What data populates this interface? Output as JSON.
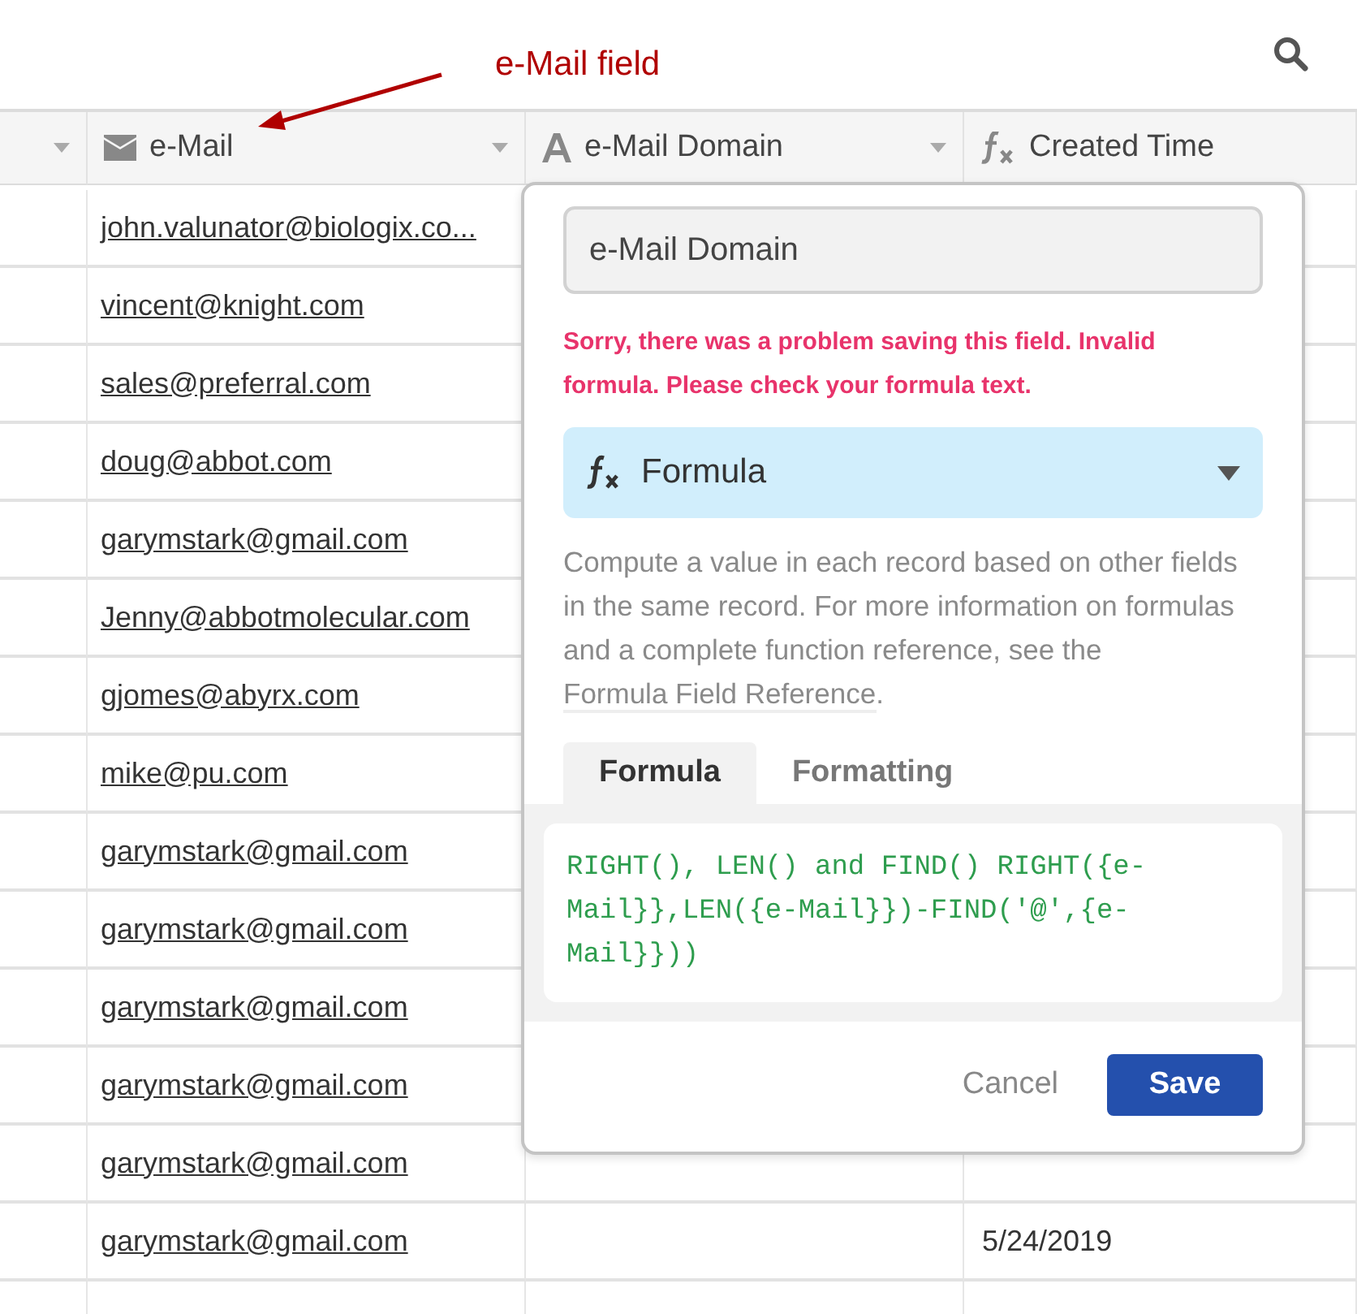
{
  "annotation": {
    "text": "e-Mail field"
  },
  "table": {
    "columns": [
      {
        "kind": "blank",
        "dropdown": true
      },
      {
        "kind": "email",
        "label": "e-Mail",
        "dropdown": true
      },
      {
        "kind": "text",
        "label": "e-Mail Domain",
        "dropdown": true
      },
      {
        "kind": "formula",
        "label": "Created Time",
        "dropdown": false
      }
    ],
    "rows": [
      {
        "email": "john.valunator@biologix.co..."
      },
      {
        "email": "vincent@knight.com"
      },
      {
        "email": "sales@preferral.com"
      },
      {
        "email": "doug@abbot.com"
      },
      {
        "email": "garymstark@gmail.com"
      },
      {
        "email": "Jenny@abbotmolecular.com"
      },
      {
        "email": "gjomes@abyrx.com"
      },
      {
        "email": "mike@pu.com"
      },
      {
        "email": "garymstark@gmail.com"
      },
      {
        "email": "garymstark@gmail.com"
      },
      {
        "email": "garymstark@gmail.com"
      },
      {
        "email": "garymstark@gmail.com"
      },
      {
        "email": "garymstark@gmail.com"
      },
      {
        "email": "garymstark@gmail.com",
        "created": "5/24/2019"
      }
    ]
  },
  "dialog": {
    "name_value": "e-Mail Domain",
    "error": "Sorry, there was a problem saving this field. Invalid formula. Please check your formula text.",
    "field_type": {
      "kind": "formula",
      "label": "Formula"
    },
    "description": "Compute a value in each record based on other fields in the same record. For more information on formulas and a complete function reference, see the",
    "link": "Formula Field Reference",
    "description_end": ".",
    "tabs": [
      {
        "label": "Formula",
        "selected": true
      },
      {
        "label": "Formatting",
        "selected": false
      }
    ],
    "formula": "RIGHT(), LEN() and FIND() RIGHT({e-Mail}},LEN({e-Mail}})-FIND('@',{e-Mail}}))",
    "buttons": {
      "cancel": "Cancel",
      "save": "Save"
    }
  }
}
